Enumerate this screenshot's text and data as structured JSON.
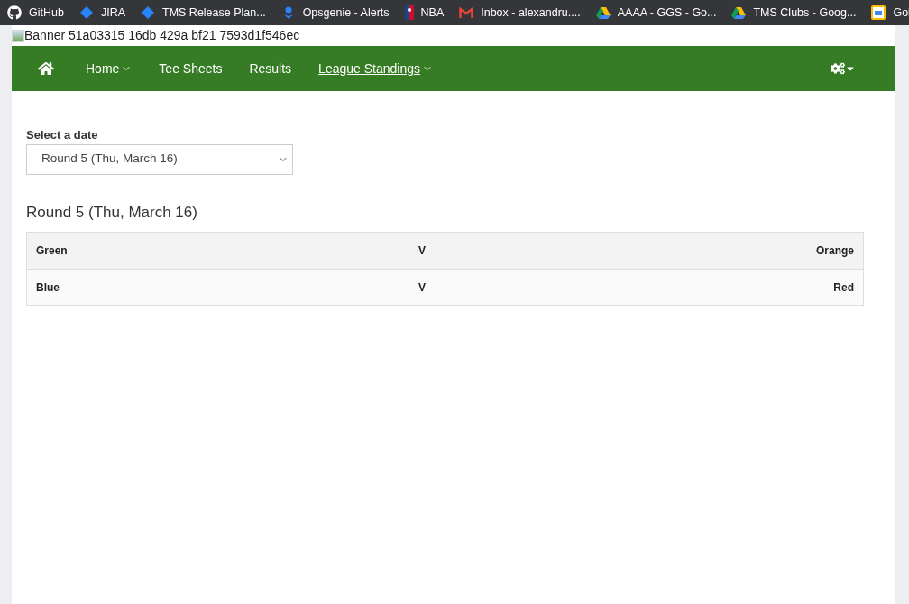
{
  "bookmarks": [
    {
      "kind": "github",
      "label": "GitHub"
    },
    {
      "kind": "jira",
      "label": "JIRA"
    },
    {
      "kind": "jira",
      "label": "TMS Release Plan..."
    },
    {
      "kind": "opsgenie",
      "label": "Opsgenie - Alerts"
    },
    {
      "kind": "nba",
      "label": "NBA"
    },
    {
      "kind": "gmail",
      "label": "Inbox - alexandru...."
    },
    {
      "kind": "drive",
      "label": "AAAA - GGS - Go..."
    },
    {
      "kind": "drive",
      "label": "TMS Clubs - Goog..."
    },
    {
      "kind": "calendar",
      "label": "Gol"
    }
  ],
  "banner": {
    "alt": "Banner 51a03315 16db 429a bf21 7593d1f546ec"
  },
  "nav": {
    "items": [
      {
        "label": "Home",
        "dropdown": true,
        "selected": false
      },
      {
        "label": "Tee Sheets",
        "dropdown": false,
        "selected": false
      },
      {
        "label": "Results",
        "dropdown": false,
        "selected": false
      },
      {
        "label": "League Standings",
        "dropdown": true,
        "selected": true
      }
    ]
  },
  "date_select": {
    "label": "Select a date",
    "value": "Round 5 (Thu, March 16)"
  },
  "round": {
    "title": "Round 5 (Thu, March 16)",
    "matches": [
      {
        "home": "Green",
        "versus": "V",
        "away": "Orange"
      },
      {
        "home": "Blue",
        "versus": "V",
        "away": "Red"
      }
    ]
  }
}
